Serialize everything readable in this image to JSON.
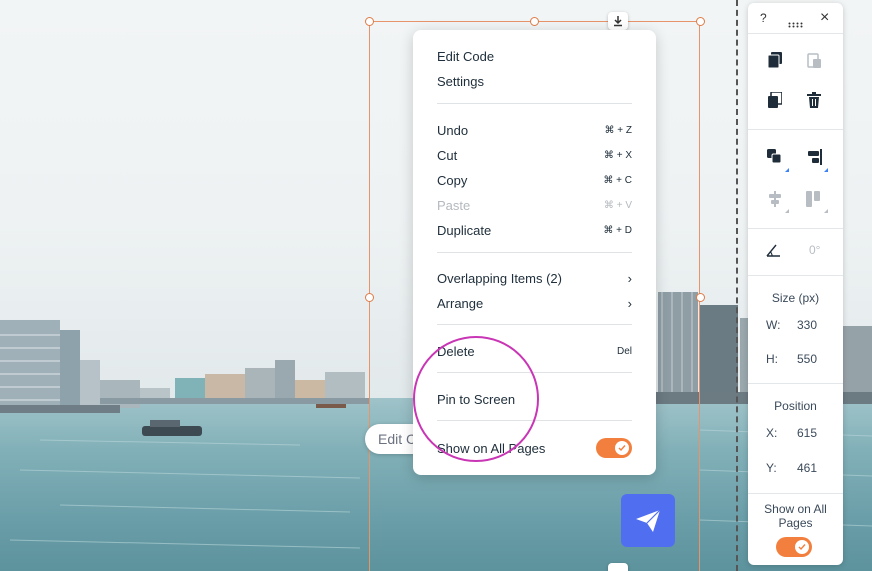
{
  "context_menu": {
    "items": [
      {
        "label": "Edit Code",
        "shortcut": ""
      },
      {
        "label": "Settings",
        "shortcut": ""
      },
      {
        "label": "Undo",
        "shortcut": "⌘ + Z"
      },
      {
        "label": "Cut",
        "shortcut": "⌘ + X"
      },
      {
        "label": "Copy",
        "shortcut": "⌘ + C"
      },
      {
        "label": "Paste",
        "shortcut": "⌘ + V",
        "disabled": true
      },
      {
        "label": "Duplicate",
        "shortcut": "⌘ + D"
      },
      {
        "label": "Overlapping Items (2)",
        "submenu": true
      },
      {
        "label": "Arrange",
        "submenu": true
      },
      {
        "label": "Delete",
        "shortcut": "Del"
      },
      {
        "label": "Pin to Screen",
        "shortcut": ""
      },
      {
        "label": "Show on All Pages",
        "toggle": true
      }
    ],
    "submenu_glyph": "›",
    "toggle_on": true
  },
  "edit_pill": {
    "label": "Edit C"
  },
  "panel": {
    "help": "?",
    "close": "×",
    "angle_value": "0°",
    "size_title": "Size (px)",
    "w_label": "W:",
    "w_value": "330",
    "h_label": "H:",
    "h_value": "550",
    "position_title": "Position",
    "x_label": "X:",
    "x_value": "615",
    "y_label": "Y:",
    "y_value": "461",
    "show_all_label": "Show on All Pages",
    "show_all_on": true
  },
  "icons": {
    "panel": [
      "help-icon",
      "drag-handle-icon",
      "close-icon",
      "copy-design-icon",
      "paste-design-icon",
      "duplicate-icon",
      "delete-icon",
      "arrange-icon",
      "align-icon",
      "distribute-icon",
      "match-size-icon",
      "rotate-icon"
    ],
    "canvas": [
      "download-icon",
      "paper-plane-icon",
      "checkmark-icon"
    ]
  },
  "colors": {
    "accent_orange": "#f27f3d",
    "selection": "#e8946a",
    "highlight": "#c936b5",
    "send_button": "#4f6ff0"
  }
}
